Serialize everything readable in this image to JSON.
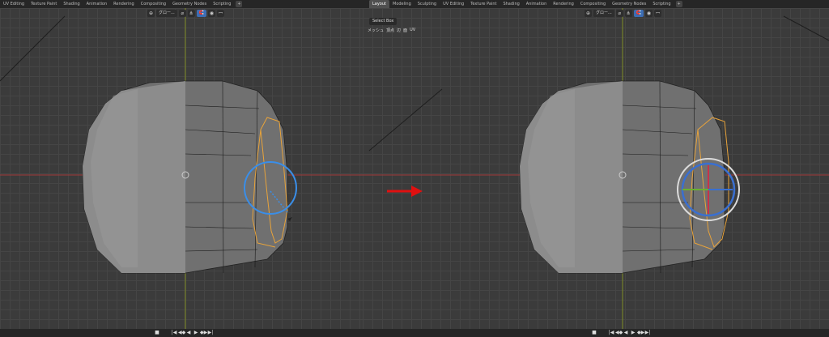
{
  "left_panel": {
    "tabs": [
      "UV Editing",
      "Texture Paint",
      "Shading",
      "Animation",
      "Rendering",
      "Compositing",
      "Geometry Nodes",
      "Scripting"
    ],
    "transform_orientation": "グロー...",
    "proportional": "ꟷ"
  },
  "right_panel": {
    "tabs": [
      "Layout",
      "Modeling",
      "Sculpting",
      "UV Editing",
      "Texture Paint",
      "Shading",
      "Animation",
      "Rendering",
      "Compositing",
      "Geometry Nodes",
      "Scripting"
    ],
    "active_tab": "Layout",
    "select_box": "Select Box",
    "mesh_modes": [
      "メッシュ",
      "頂点",
      "辺",
      "面",
      "UV"
    ],
    "transform_orientation": "グロー...",
    "proportional": "ꟷ"
  },
  "tab_plus": "+",
  "playback": [
    "■",
    "|◀",
    "◀◆",
    "◀",
    "▶",
    "◆▶",
    "▶|"
  ],
  "colors": {
    "accent": "#3d6db3",
    "select": "#e8a33a",
    "x_axis": "#b23a3a",
    "y_axis": "#8a9a2a",
    "arrow": "#e01010"
  },
  "icons": [
    "pivot-icon",
    "snap-icon",
    "proportional-icon",
    "play-icon",
    "arrow-right-icon"
  ]
}
